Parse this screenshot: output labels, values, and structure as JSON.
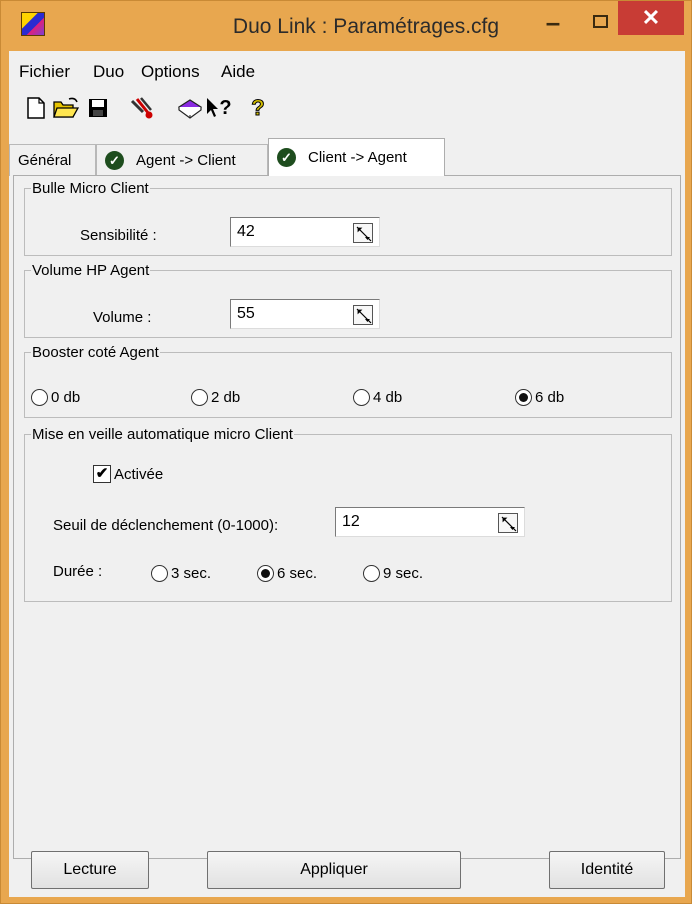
{
  "window": {
    "title": "Duo Link : Paramétrages.cfg",
    "close_glyph": "✕",
    "min_glyph": "–"
  },
  "menu": {
    "items": [
      {
        "label": "Fichier"
      },
      {
        "label": "Duo"
      },
      {
        "label": "Options"
      },
      {
        "label": "Aide"
      }
    ]
  },
  "toolbar": {
    "icons": [
      "new-file-icon",
      "open-folder-icon",
      "save-icon",
      "wrench-tools-icon",
      "book-icon",
      "pointer-help-icon",
      "question-icon"
    ],
    "help_glyph": "?",
    "question_glyph": "?"
  },
  "tabs": [
    {
      "label": "Général",
      "active": false,
      "checked": false
    },
    {
      "label": "Agent -> Client",
      "active": false,
      "checked": true
    },
    {
      "label": "Client -> Agent",
      "active": true,
      "checked": true
    }
  ],
  "bulle": {
    "legend": "Bulle Micro Client",
    "label": "Sensibilité :",
    "value": "42"
  },
  "volume": {
    "legend": "Volume HP Agent",
    "label": "Volume :",
    "value": "55"
  },
  "booster": {
    "legend": "Booster coté Agent",
    "options": [
      {
        "label": "0 db",
        "selected": false
      },
      {
        "label": "2 db",
        "selected": false
      },
      {
        "label": "4 db",
        "selected": false
      },
      {
        "label": "6 db",
        "selected": true
      }
    ]
  },
  "veille": {
    "legend": "Mise en veille automatique micro Client",
    "checkbox_label": "Activée",
    "checked": true,
    "check_glyph": "✔",
    "seuil_label": "Seuil de déclenchement (0-1000):",
    "seuil_value": "12",
    "duree_label": "Durée :",
    "duree_options": [
      {
        "label": "3 sec.",
        "selected": false
      },
      {
        "label": "6 sec.",
        "selected": true
      },
      {
        "label": "9 sec.",
        "selected": false
      }
    ]
  },
  "buttons": {
    "lecture": "Lecture",
    "appliquer": "Appliquer",
    "identite": "Identité"
  },
  "colors": {
    "titlebar": "#e8a74f",
    "close": "#c83c35",
    "check_badge": "#1e4d1e"
  }
}
